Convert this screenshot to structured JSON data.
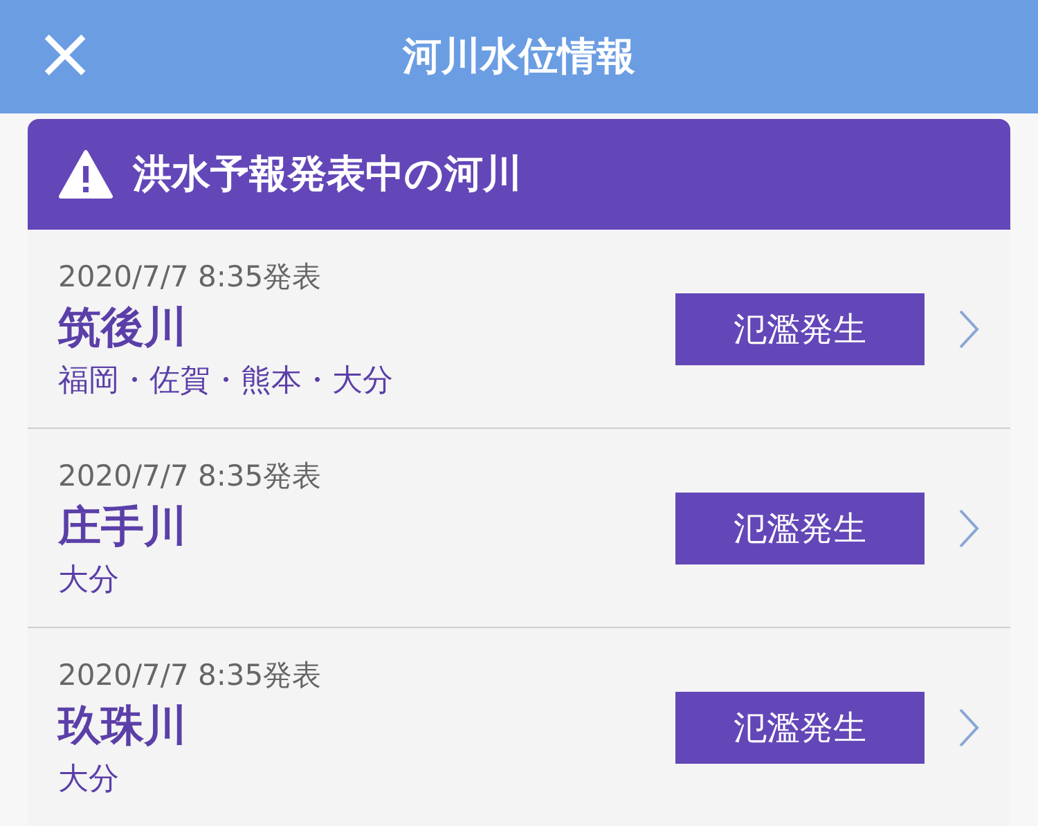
{
  "header": {
    "close": "×",
    "title": "河川水位情報"
  },
  "panel": {
    "title": "洪水予報発表中の河川",
    "rivers": [
      {
        "time": "2020/7/7 8:35発表",
        "name": "筑後川",
        "areas": "福岡・佐賀・熊本・大分",
        "status": "氾濫発生"
      },
      {
        "time": "2020/7/7 8:35発表",
        "name": "庄手川",
        "areas": "大分",
        "status": "氾濫発生"
      },
      {
        "time": "2020/7/7 8:35発表",
        "name": "玖珠川",
        "areas": "大分",
        "status": "氾濫発生"
      }
    ]
  }
}
